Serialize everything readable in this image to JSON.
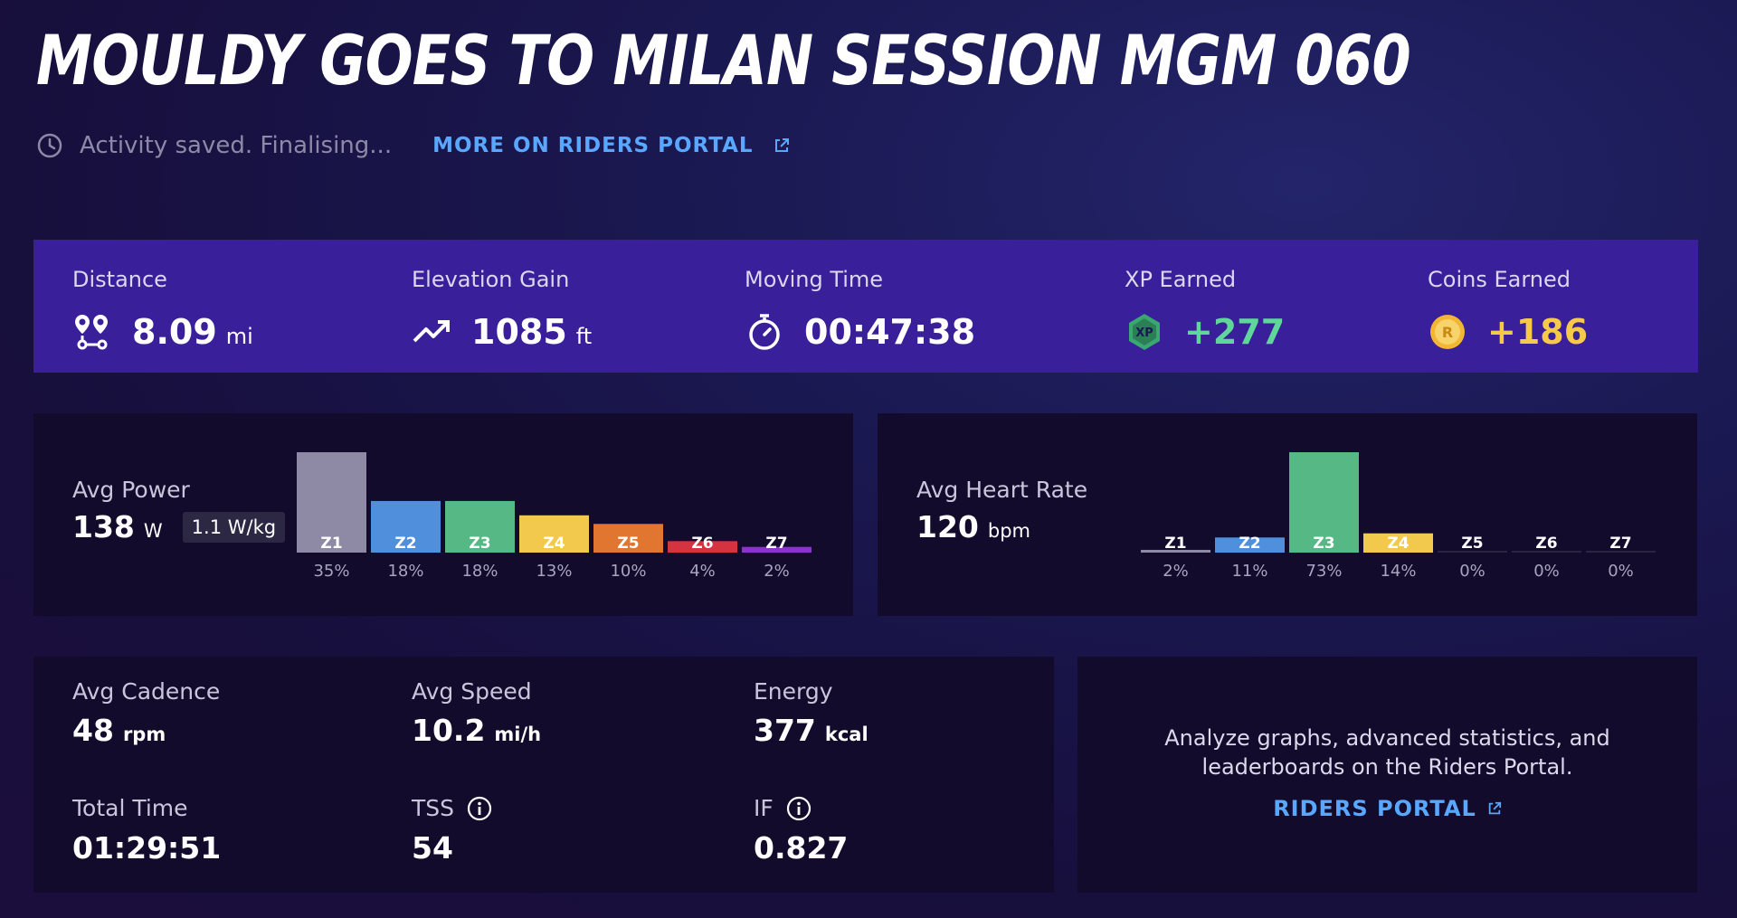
{
  "header": {
    "title": "MOULDY GOES TO MILAN SESSION MGM 060",
    "status": "Activity saved. Finalising...",
    "portal_link": "MORE ON RIDERS PORTAL"
  },
  "summary": {
    "distance": {
      "label": "Distance",
      "value": "8.09",
      "unit": "mi",
      "icon": "route-icon"
    },
    "elevation": {
      "label": "Elevation Gain",
      "value": "1085",
      "unit": "ft",
      "icon": "trending-up-icon"
    },
    "moving_time": {
      "label": "Moving Time",
      "value": "00:47:38",
      "icon": "stopwatch-icon"
    },
    "xp": {
      "label": "XP Earned",
      "value": "+277",
      "badge": "XP",
      "icon": "xp-badge-icon"
    },
    "coins": {
      "label": "Coins Earned",
      "value": "+186",
      "badge": "R",
      "icon": "coin-icon"
    }
  },
  "power": {
    "label": "Avg Power",
    "value": "138",
    "unit": "W",
    "wkg": "1.1 W/kg"
  },
  "heart_rate": {
    "label": "Avg Heart Rate",
    "value": "120",
    "unit": "bpm"
  },
  "stats": {
    "cadence": {
      "label": "Avg Cadence",
      "value": "48",
      "unit": "rpm"
    },
    "speed": {
      "label": "Avg Speed",
      "value": "10.2",
      "unit": "mi/h"
    },
    "energy": {
      "label": "Energy",
      "value": "377",
      "unit": "kcal"
    },
    "total_time": {
      "label": "Total Time",
      "value": "01:29:51"
    },
    "tss": {
      "label": "TSS",
      "value": "54"
    },
    "if": {
      "label": "IF",
      "value": "0.827"
    }
  },
  "promo": {
    "line1": "Analyze graphs, advanced statistics, and",
    "line2": "leaderboards on the Riders Portal.",
    "link": "RIDERS PORTAL"
  },
  "colors": {
    "z1": "#8e8aa6",
    "z2": "#4f8fdc",
    "z3": "#55b885",
    "z4": "#f2c94c",
    "z5": "#e07630",
    "z6": "#d63341",
    "z7": "#8a34c9",
    "link": "#5aa7ff",
    "summary_bg": "#3a1f9a"
  },
  "chart_data": [
    {
      "type": "bar",
      "name": "power-zones",
      "categories": [
        "Z1",
        "Z2",
        "Z3",
        "Z4",
        "Z5",
        "Z6",
        "Z7"
      ],
      "values": [
        35,
        18,
        18,
        13,
        10,
        4,
        2
      ],
      "labels": [
        "35%",
        "18%",
        "18%",
        "13%",
        "10%",
        "4%",
        "2%"
      ]
    },
    {
      "type": "bar",
      "name": "heart-rate-zones",
      "categories": [
        "Z1",
        "Z2",
        "Z3",
        "Z4",
        "Z5",
        "Z6",
        "Z7"
      ],
      "values": [
        2,
        11,
        73,
        14,
        0,
        0,
        0
      ],
      "labels": [
        "2%",
        "11%",
        "73%",
        "14%",
        "0%",
        "0%",
        "0%"
      ]
    }
  ]
}
